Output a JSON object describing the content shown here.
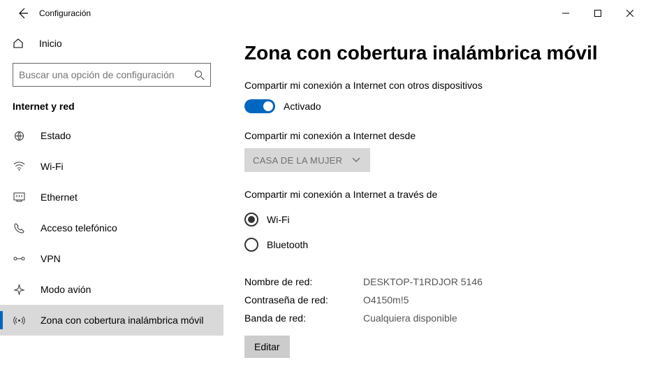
{
  "titlebar": {
    "title": "Configuración"
  },
  "sidebar": {
    "home_label": "Inicio",
    "search_placeholder": "Buscar una opción de configuración",
    "section": "Internet y red",
    "items": [
      {
        "label": "Estado"
      },
      {
        "label": "Wi-Fi"
      },
      {
        "label": "Ethernet"
      },
      {
        "label": "Acceso telefónico"
      },
      {
        "label": "VPN"
      },
      {
        "label": "Modo avión"
      },
      {
        "label": "Zona con cobertura inalámbrica móvil"
      }
    ]
  },
  "main": {
    "heading": "Zona con cobertura inalámbrica móvil",
    "share_label": "Compartir mi conexión a Internet con otros dispositivos",
    "toggle_state": "Activado",
    "share_from_label": "Compartir mi conexión a Internet desde",
    "share_from_value": "CASA DE LA MUJER",
    "share_over_label": "Compartir mi conexión a Internet a través de",
    "radio_wifi": "Wi-Fi",
    "radio_bt": "Bluetooth",
    "info": [
      {
        "k": "Nombre de red:",
        "v": "DESKTOP-T1RDJOR 5146"
      },
      {
        "k": "Contraseña de red:",
        "v": "O4150m!5"
      },
      {
        "k": "Banda de red:",
        "v": "Cualquiera disponible"
      }
    ],
    "edit_label": "Editar"
  }
}
